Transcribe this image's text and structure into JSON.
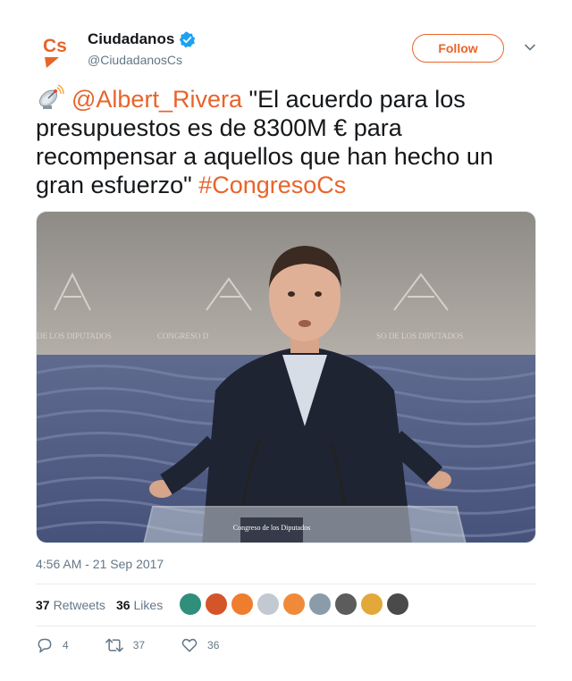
{
  "account": {
    "name": "Ciudadanos",
    "handle": "@CiudadanosCs",
    "avatar_text": "Cs",
    "follow_label": "Follow"
  },
  "tweet": {
    "mention": "@Albert_Rivera",
    "text_part1": " \"El acuerdo para los presupuestos es de 8300M € para recompensar a aquellos que han hecho un gran esfuerzo\" ",
    "hashtag": "#CongresoCs",
    "emoji": "satellite-antenna-icon"
  },
  "media": {
    "podium_sign": "Congreso de los Diputados",
    "wall_text_left": "DE LOS DIPUTADOS",
    "wall_text_center": "CONGRESO D",
    "wall_text_right": "SO DE LOS DIPUTADOS"
  },
  "timestamp": "4:56 AM - 21 Sep 2017",
  "stats": {
    "retweets_count": "37",
    "retweets_label": "Retweets",
    "likes_count": "36",
    "likes_label": "Likes"
  },
  "actions": {
    "reply_count": "4",
    "retweet_count": "37",
    "like_count": "36"
  },
  "colors": {
    "brand": "#e8642a",
    "text": "#14171a",
    "muted": "#657786",
    "verified": "#1da1f2"
  }
}
